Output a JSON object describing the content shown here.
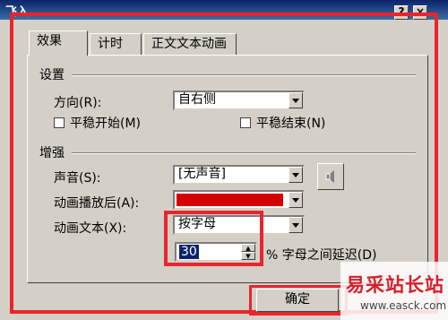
{
  "window": {
    "title": "飞入",
    "help_glyph": "?",
    "close_glyph": "×"
  },
  "tabs": [
    {
      "label": "效果",
      "active": true
    },
    {
      "label": "计时",
      "active": false
    },
    {
      "label": "正文文本动画",
      "active": false
    }
  ],
  "settings": {
    "section_title": "设置",
    "direction": {
      "label": "方向(R):",
      "value": "自右侧"
    },
    "smooth_start": {
      "label": "平稳开始(M)",
      "checked": false
    },
    "smooth_end": {
      "label": "平稳结束(N)",
      "checked": false
    }
  },
  "enhance": {
    "section_title": "增强",
    "sound": {
      "label": "声音(S):",
      "value": "[无声音]"
    },
    "after_animation": {
      "label": "动画播放后(A):",
      "color": "#d40000"
    },
    "animate_text": {
      "label": "动画文本(X):",
      "value": "按字母"
    },
    "delay": {
      "value": "30",
      "suffix": "% 字母之间延迟(D)"
    }
  },
  "buttons": {
    "ok": "确定"
  },
  "watermark": {
    "text": "易采站长站",
    "url": "www.easck.com"
  },
  "colors": {
    "highlight_red": "#e8252c",
    "title_bar": "#0a246a",
    "watermark_red": "#d81e2a"
  },
  "icons": {
    "sound": "speaker-icon"
  }
}
